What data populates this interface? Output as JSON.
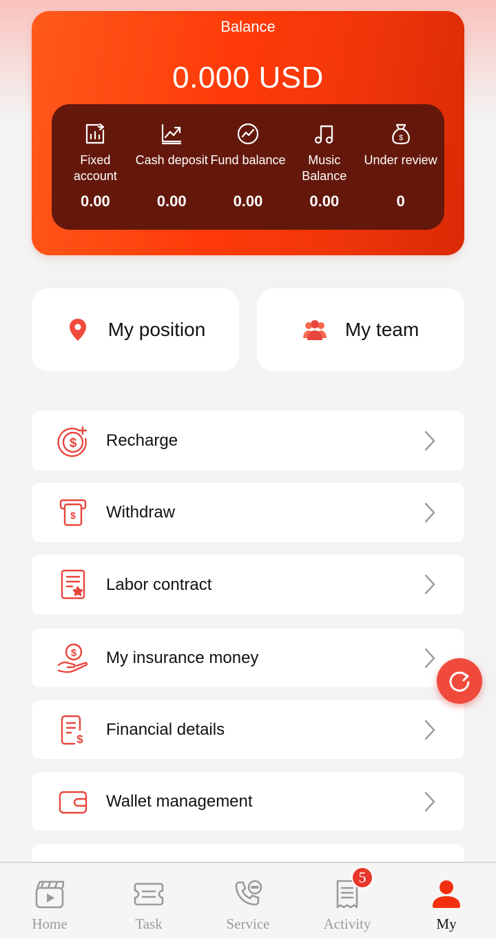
{
  "balance": {
    "title": "Balance",
    "amount": "0.000 USD",
    "stats": [
      {
        "label": "Fixed account",
        "value": "0.00",
        "icon": "bar-chart-icon"
      },
      {
        "label": "Cash deposit",
        "value": "0.00",
        "icon": "trend-up-icon"
      },
      {
        "label": "Fund balance",
        "value": "0.00",
        "icon": "trend-circle-icon"
      },
      {
        "label": "Music Balance",
        "value": "0.00",
        "icon": "music-note-icon"
      },
      {
        "label": "Under review",
        "value": "0",
        "icon": "money-bag-icon"
      }
    ]
  },
  "quick": {
    "position_label": "My position",
    "team_label": "My team"
  },
  "menu": [
    {
      "label": "Recharge",
      "icon": "dollar-plus-icon"
    },
    {
      "label": "Withdraw",
      "icon": "atm-withdraw-icon"
    },
    {
      "label": "Labor contract",
      "icon": "contract-icon"
    },
    {
      "label": "My insurance money",
      "icon": "hand-coin-icon"
    },
    {
      "label": "Financial details",
      "icon": "document-dollar-icon"
    },
    {
      "label": "Wallet management",
      "icon": "wallet-icon"
    }
  ],
  "tabbar": {
    "items": [
      {
        "label": "Home",
        "icon": "clapperboard-icon"
      },
      {
        "label": "Task",
        "icon": "ticket-icon"
      },
      {
        "label": "Service",
        "icon": "phone-chat-icon"
      },
      {
        "label": "Activity",
        "icon": "receipt-icon",
        "badge": "5"
      },
      {
        "label": "My",
        "icon": "user-icon",
        "active": true
      }
    ]
  },
  "colors": {
    "accent": "#ff3a08",
    "icon_red": "#e8453c",
    "stats_bg": "#64180b",
    "tab_inactive": "#9a9a9a"
  }
}
